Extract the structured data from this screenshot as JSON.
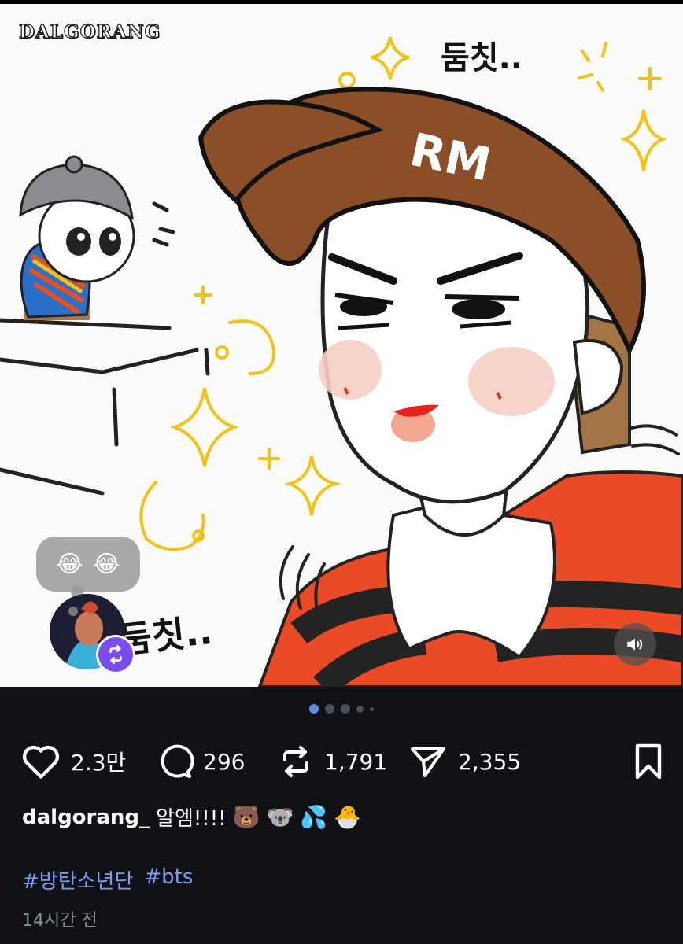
{
  "media": {
    "watermark": "DALGORANG",
    "sfx_top": "둠칫..",
    "sfx_bottom": "둠칫..",
    "cap_text": "RM",
    "reaction_emojis": [
      "😂",
      "😂"
    ],
    "sound_icon": "speaker-icon"
  },
  "carousel": {
    "dots": 5,
    "active_index": 0
  },
  "actions": {
    "likes": "2.3만",
    "comments": "296",
    "reposts": "1,791",
    "shares": "2,355"
  },
  "caption": {
    "username": "dalgorang_",
    "text": "알엠!!!!",
    "emojis": [
      "🐻",
      "🐨",
      "💦",
      "🐣"
    ]
  },
  "hashtags": [
    "#방탄소년단",
    "#bts"
  ],
  "timestamp": "14시간 전",
  "colors": {
    "background": "#0f1115",
    "hashtag": "#7b9ef5",
    "active_dot": "#5b8def",
    "repost_badge": "#7b4cf0"
  }
}
